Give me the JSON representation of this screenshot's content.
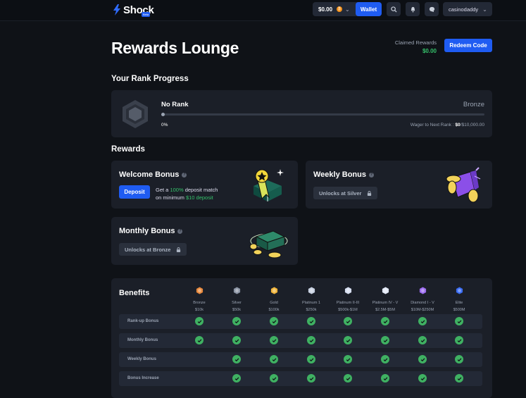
{
  "header": {
    "brand": "Shock",
    "beta": "Beta",
    "balance": "$0.00",
    "wallet_label": "Wallet",
    "username": "casinodaddy"
  },
  "page": {
    "title": "Rewards Lounge",
    "claimed_label": "Claimed Rewards",
    "claimed_value": "$0.00",
    "redeem_label": "Redeem Code"
  },
  "rank": {
    "section_title": "Your Rank Progress",
    "current": "No Rank",
    "next": "Bronze",
    "percent": "0%",
    "progress_fraction": 0,
    "wager_label": "Wager to Next Rank :",
    "wager_current": "$0",
    "wager_target": "/$10,000.00"
  },
  "rewards": {
    "section_title": "Rewards",
    "welcome": {
      "title": "Welcome Bonus",
      "button": "Deposit",
      "line1_a": "Get a ",
      "line1_b": "100%",
      "line1_c": " deposit match",
      "line2_a": "on minimum ",
      "line2_b": "$10 deposit"
    },
    "weekly": {
      "title": "Weekly Bonus",
      "locked": "Unlocks at Silver"
    },
    "monthly": {
      "title": "Monthly Bonus",
      "locked": "Unlocks at Bronze"
    }
  },
  "benefits": {
    "title": "Benefits",
    "tiers": [
      {
        "name": "Bronze",
        "value": "$10k",
        "color": "#e8893c"
      },
      {
        "name": "Silver",
        "value": "$50k",
        "color": "#8a93a3"
      },
      {
        "name": "Gold",
        "value": "$100k",
        "color": "#f0b43a"
      },
      {
        "name": "Platinum 1",
        "value": "$250k",
        "color": "#c7d0e0"
      },
      {
        "name": "Platinum II-III",
        "value": "$500k-$1M",
        "color": "#d6def0"
      },
      {
        "name": "Platinum IV - V",
        "value": "$2.5M-$5M",
        "color": "#e3e9f7"
      },
      {
        "name": "Diamond I - V",
        "value": "$10M-$250M",
        "color": "#9c6cf0"
      },
      {
        "name": "Elite",
        "value": "$500M",
        "color": "#3a6cf4"
      }
    ],
    "rows": [
      {
        "label": "Rank-up Bonus",
        "checks": [
          true,
          true,
          true,
          true,
          true,
          true,
          true,
          true
        ]
      },
      {
        "label": "Monthly Bonus",
        "checks": [
          true,
          true,
          true,
          true,
          true,
          true,
          true,
          true
        ]
      },
      {
        "label": "Weekly Bonus",
        "checks": [
          false,
          true,
          true,
          true,
          true,
          true,
          true,
          true
        ]
      },
      {
        "label": "Bonus Increase",
        "checks": [
          false,
          true,
          true,
          true,
          true,
          true,
          true,
          true
        ]
      }
    ]
  }
}
